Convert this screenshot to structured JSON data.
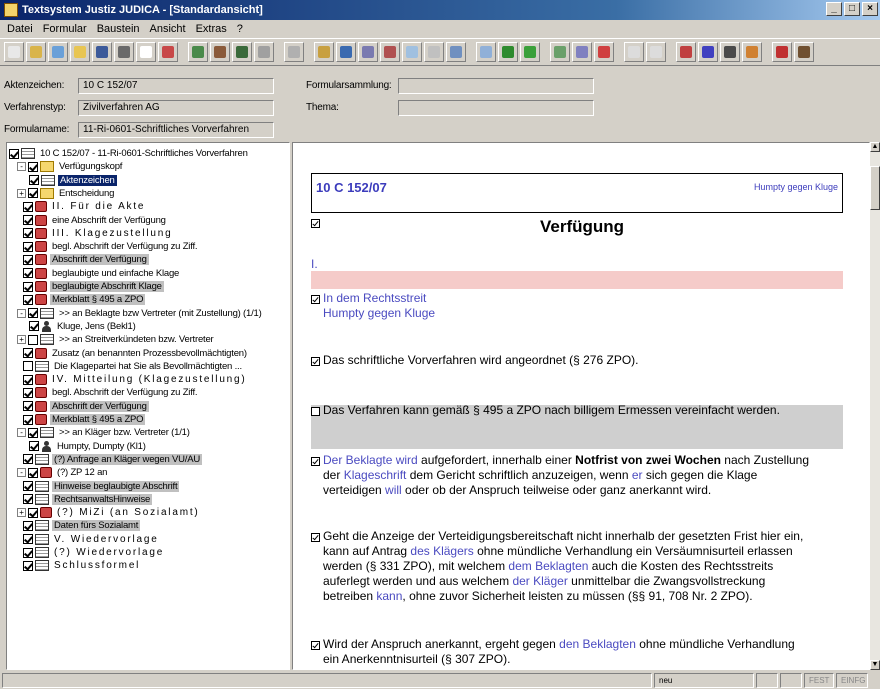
{
  "window": {
    "title": "Textsystem Justiz JUDICA - [Standardansicht]",
    "controls": [
      "_",
      "□",
      "×"
    ]
  },
  "menu": [
    "Datei",
    "Formular",
    "Baustein",
    "Ansicht",
    "Extras",
    "?"
  ],
  "toolbar": {
    "icons": [
      "new-doc-icon",
      "open-doc-icon",
      "print-preview-icon",
      "folder-icon",
      "save-icon",
      "print-icon",
      "preview-icon",
      "text-block-icon",
      "form-icon",
      "macro-icon",
      "step-icon",
      "play-icon",
      "cut-icon",
      "copy-icon",
      "paste-icon",
      "edit-icon",
      "undo-icon",
      "find-icon",
      "replace-icon",
      "nav-first-icon",
      "nav-prev-icon",
      "green-record-icon",
      "green-db-icon",
      "field-icon",
      "settings-icon",
      "help-icon",
      "disabled-a-icon",
      "disabled-b-icon",
      "mail-icon",
      "merge-icon",
      "calc-icon",
      "tools-icon",
      "info-icon",
      "exit-icon"
    ],
    "colors": [
      "#e8e8e8",
      "#d9b44a",
      "#6aa0d8",
      "#e8c552",
      "#3c5a9a",
      "#6a6a6a",
      "#ffffff",
      "#c84848",
      "#4a8a4a",
      "#8a5a3a",
      "#3a6a3a",
      "#a0a0a0",
      "#b0b0b0",
      "#c8a040",
      "#3a6ab0",
      "#7a7ab0",
      "#b05050",
      "#a0c0e0",
      "#c0c0c0",
      "#7090c0",
      "#90b0d8",
      "#2e8b2e",
      "#3aa03a",
      "#6aa06a",
      "#8080c0",
      "#d04040",
      "#dcdcdc",
      "#dcdcdc",
      "#c04040",
      "#4040c0",
      "#4a4a4a",
      "#d08030",
      "#c03030",
      "#705030"
    ]
  },
  "fields": {
    "aktenzeichen_label": "Aktenzeichen:",
    "aktenzeichen_value": "10 C 152/07",
    "verfahrenstyp_label": "Verfahrenstyp:",
    "verfahrenstyp_value": "Zivilverfahren AG",
    "formularname_label": "Formularname:",
    "formularname_value": "11-Ri-0601-Schriftliches Vorverfahren",
    "formularsammlung_label": "Formularsammlung:",
    "formularsammlung_value": "",
    "thema_label": "Thema:",
    "thema_value": ""
  },
  "tree": [
    {
      "label": "10 C 152/07 - 11-Ri-0601-Schriftliches Vorverfahren",
      "exp": "",
      "chk": true,
      "icon": "doc",
      "style": ""
    },
    {
      "label": "Verfügungskopf",
      "exp": "-",
      "chk": true,
      "icon": "fold",
      "style": ""
    },
    {
      "label": "Aktenzeichen",
      "exp": "",
      "chk": true,
      "icon": "doc",
      "style": "sel"
    },
    {
      "label": "Entscheidung",
      "exp": "+",
      "chk": true,
      "icon": "fold",
      "style": ""
    },
    {
      "label": "II. Für die Akte",
      "exp": "",
      "chk": true,
      "icon": "stamp",
      "style": "spaced"
    },
    {
      "label": "eine Abschrift der Verfügung",
      "exp": "",
      "chk": true,
      "icon": "stamp",
      "style": ""
    },
    {
      "label": "III. Klagezustellung",
      "exp": "",
      "chk": true,
      "icon": "stamp",
      "style": "spaced"
    },
    {
      "label": "begl. Abschrift der Verfügung zu Ziff.",
      "exp": "",
      "chk": true,
      "icon": "stamp",
      "style": ""
    },
    {
      "label": "Abschrift der Verfügung",
      "exp": "",
      "chk": true,
      "icon": "stamp",
      "style": "hl"
    },
    {
      "label": "beglaubigte und einfache Klage",
      "exp": "",
      "chk": true,
      "icon": "stamp",
      "style": ""
    },
    {
      "label": "beglaubigte Abschrift Klage",
      "exp": "",
      "chk": true,
      "icon": "stamp",
      "style": "hl"
    },
    {
      "label": "Merkblatt § 495 a ZPO",
      "exp": "",
      "chk": true,
      "icon": "stamp",
      "style": "hl"
    },
    {
      "label": ">> an Beklagte bzw Vertreter (mit Zustellung) (1/1)",
      "exp": "-",
      "chk": true,
      "icon": "doc",
      "style": ""
    },
    {
      "label": "Kluge, Jens (Bekl1)",
      "exp": "",
      "chk": true,
      "icon": "person",
      "style": ""
    },
    {
      "label": ">> an Streitverkündeten bzw. Vertreter",
      "exp": "+",
      "chk": false,
      "icon": "doc",
      "style": ""
    },
    {
      "label": "Zusatz (an benannten Prozessbevollmächtigten)",
      "exp": "",
      "chk": true,
      "icon": "stamp",
      "style": ""
    },
    {
      "label": "Die Klagepartei hat Sie als Bevollmächtigten ...",
      "exp": "",
      "chk": false,
      "icon": "doc",
      "style": ""
    },
    {
      "label": "IV. Mitteilung (Klagezustellung)",
      "exp": "",
      "chk": true,
      "icon": "stamp",
      "style": "spaced"
    },
    {
      "label": "begl. Abschrift der Verfügung zu Ziff.",
      "exp": "",
      "chk": true,
      "icon": "stamp",
      "style": ""
    },
    {
      "label": "Abschrift der Verfügung",
      "exp": "",
      "chk": true,
      "icon": "stamp",
      "style": "hl"
    },
    {
      "label": "Merkblatt § 495 a ZPO",
      "exp": "",
      "chk": true,
      "icon": "stamp",
      "style": "hl"
    },
    {
      "label": ">> an Kläger bzw. Vertreter (1/1)",
      "exp": "-",
      "chk": true,
      "icon": "doc",
      "style": ""
    },
    {
      "label": "Humpty, Dumpty (Kl1)",
      "exp": "",
      "chk": true,
      "icon": "person",
      "style": ""
    },
    {
      "label": "(?) Anfrage an Kläger wegen VU/AU",
      "exp": "",
      "chk": true,
      "icon": "doc",
      "style": "hl"
    },
    {
      "label": "(?) ZP 12 an",
      "exp": "-",
      "chk": true,
      "icon": "stamp",
      "style": ""
    },
    {
      "label": "Hinweise beglaubigte Abschrift",
      "exp": "",
      "chk": true,
      "icon": "doc",
      "style": "hl"
    },
    {
      "label": "RechtsanwaltsHinweise",
      "exp": "",
      "chk": true,
      "icon": "doc",
      "style": "hl"
    },
    {
      "label": "(?) MiZi (an Sozialamt)",
      "exp": "+",
      "chk": true,
      "icon": "stamp",
      "style": "spaced"
    },
    {
      "label": "Daten fürs Sozialamt",
      "exp": "",
      "chk": true,
      "icon": "doc",
      "style": "hl"
    },
    {
      "label": "V. Wiedervorlage",
      "exp": "",
      "chk": true,
      "icon": "doc",
      "style": "spaced"
    },
    {
      "label": "(?) Wiedervorlage",
      "exp": "",
      "chk": true,
      "icon": "doc",
      "style": "spaced"
    },
    {
      "label": "Schlussformel",
      "exp": "",
      "chk": true,
      "icon": "doc",
      "style": "spaced"
    }
  ],
  "document": {
    "aktenzeichen": "10 C 152/07",
    "parties": "Humpty gegen Kluge",
    "title": "Verfügung",
    "roman_one": "I.",
    "rechtsstreit_line1": "In dem Rechtsstreit",
    "rechtsstreit_line2": "Humpty gegen Kluge",
    "para_vorverfahren": "Das schriftliche Vorverfahren wird angeordnet (§ 276 ZPO).",
    "para_495a": "Das Verfahren kann gemäß § 495 a ZPO nach billigem Ermessen vereinfacht werden.",
    "para_frist": {
      "l1_a": "Der Beklagte wird",
      "l1_b": " aufgefordert, innerhalb einer ",
      "l1_c": "Notfrist von zwei Wochen",
      "l1_d": " nach Zustellung",
      "l2_a": "der ",
      "l2_b": "Klageschrift",
      "l2_c": " dem Gericht schriftlich anzuzeigen, wenn ",
      "l2_d": "er",
      "l2_e": " sich gegen die Klage",
      "l3_a": "verteidigen ",
      "l3_b": "will",
      "l3_c": " oder ob der Anspruch teilweise oder ganz anerkannt wird."
    },
    "para_anzeige": {
      "l1": "Geht die Anzeige der Verteidigungsbereitschaft nicht innerhalb der gesetzten Frist hier ein,",
      "l2_a": "kann auf Antrag ",
      "l2_b": "des Klägers",
      "l2_c": " ohne mündliche Verhandlung ein Versäumnisurteil erlassen",
      "l3_a": "werden (§ 331 ZPO), mit welchem ",
      "l3_b": "dem Beklagten",
      "l3_c": " auch die Kosten des Rechtsstreits",
      "l4_a": "auferlegt werden und aus welchem ",
      "l4_b": "der Kläger",
      "l4_c": " unmittelbar die Zwangsvollstreckung",
      "l5_a": "betreiben ",
      "l5_b": "kann",
      "l5_c": ", ohne zuvor Sicherheit leisten zu müssen (§§ 91, 708 Nr. 2 ZPO)."
    },
    "para_anerkannt": {
      "l1_a": "Wird der Anspruch anerkannt, ergeht gegen ",
      "l1_b": "den Beklagten",
      "l1_c": " ohne mündliche Verhandlung",
      "l2": "ein Anerkenntnisurteil (§ 307 ZPO)."
    }
  },
  "statusbar": {
    "mode": "neu",
    "fest": "FEST",
    "einfg": "EINFG"
  }
}
